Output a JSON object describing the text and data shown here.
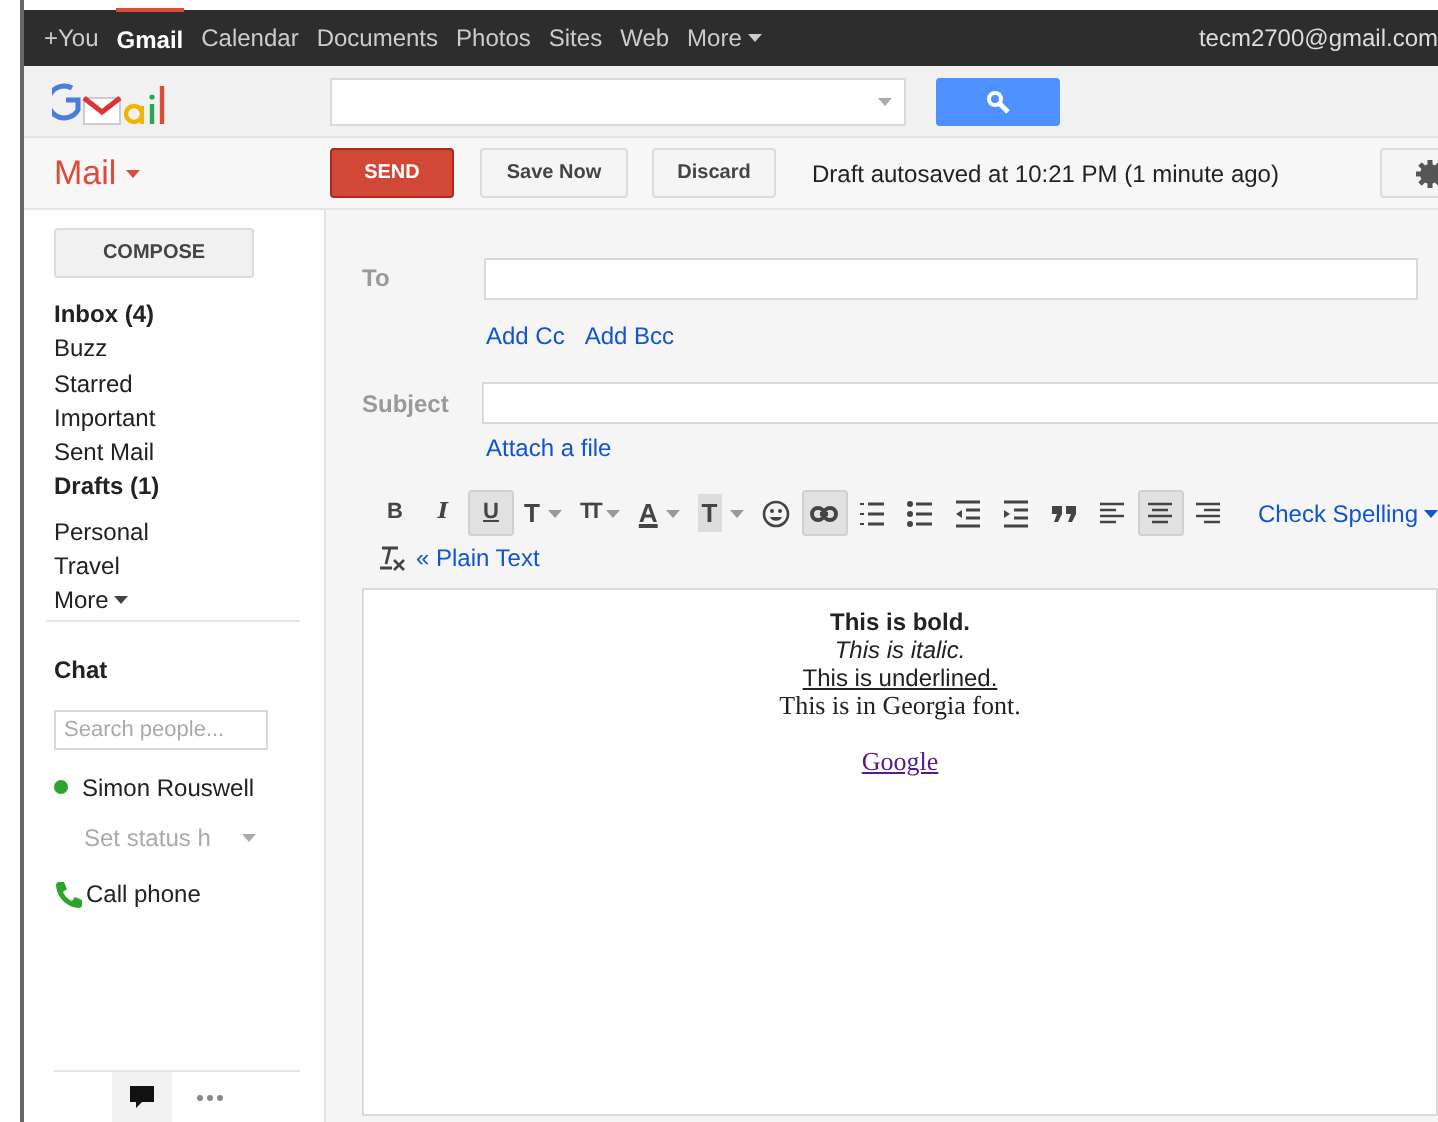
{
  "top_bar": {
    "links": [
      {
        "label": "+You",
        "selected": false
      },
      {
        "label": "Gmail",
        "selected": true
      },
      {
        "label": "Calendar",
        "selected": false
      },
      {
        "label": "Documents",
        "selected": false
      },
      {
        "label": "Photos",
        "selected": false
      },
      {
        "label": "Sites",
        "selected": false
      },
      {
        "label": "Web",
        "selected": false
      },
      {
        "label": "More",
        "selected": false,
        "menu": true
      }
    ],
    "account": "tecm2700@gmail.com"
  },
  "mail_menu": "Mail",
  "actions": {
    "send": "SEND",
    "save": "Save Now",
    "discard": "Discard",
    "status": "Draft autosaved at 10:21 PM (1 minute ago)"
  },
  "sidebar": {
    "compose": "COMPOSE",
    "items": [
      {
        "label": "Inbox (4)",
        "bold": true
      },
      {
        "label": "Buzz",
        "bold": false
      },
      {
        "label": "Starred",
        "bold": false
      },
      {
        "label": "Important",
        "bold": false
      },
      {
        "label": "Sent Mail",
        "bold": false
      },
      {
        "label": "Drafts (1)",
        "bold": true
      }
    ],
    "labels": [
      "Personal",
      "Travel"
    ],
    "more": "More"
  },
  "chat": {
    "title": "Chat",
    "search_placeholder": "Search people...",
    "contacts": [
      {
        "name": "Simon Rouswell",
        "color": "#2ca52c"
      }
    ],
    "status_placeholder": "Set status h",
    "call": "Call phone"
  },
  "compose": {
    "to_label": "To",
    "add_cc": "Add Cc",
    "add_bcc": "Add Bcc",
    "subject_label": "Subject",
    "attach": "Attach a file",
    "tools": [
      {
        "kind": "bold",
        "glyph": "B",
        "selected": false
      },
      {
        "kind": "italic",
        "glyph": "I",
        "selected": false
      },
      {
        "kind": "underline",
        "glyph": "U",
        "selected": true
      },
      {
        "kind": "font",
        "glyph": "T",
        "selected": false,
        "menu": true
      },
      {
        "kind": "size",
        "glyph": "TT",
        "selected": false,
        "menu": true
      },
      {
        "kind": "color",
        "glyph": "A",
        "selected": false,
        "menu": true
      },
      {
        "kind": "highlight",
        "glyph": "T",
        "selected": false,
        "menu": true
      },
      {
        "kind": "emoji",
        "selected": false
      },
      {
        "kind": "link",
        "selected": true
      },
      {
        "kind": "numbered",
        "selected": false
      },
      {
        "kind": "bulleted",
        "selected": false
      },
      {
        "kind": "outdent",
        "selected": false
      },
      {
        "kind": "indent",
        "selected": false
      },
      {
        "kind": "quote",
        "selected": false
      },
      {
        "kind": "align-left",
        "selected": false
      },
      {
        "kind": "align-center",
        "selected": true
      },
      {
        "kind": "align-right",
        "selected": false
      }
    ],
    "spelling": "Check Spelling",
    "plain_text": "« Plain Text",
    "body": [
      {
        "kind": "bold",
        "text": "This is bold."
      },
      {
        "kind": "italic",
        "text": "This is italic."
      },
      {
        "kind": "underline",
        "text": "This is underlined."
      },
      {
        "kind": "serif",
        "text": "This is in Georgia font."
      },
      {
        "kind": "link",
        "text": "Google"
      }
    ]
  }
}
